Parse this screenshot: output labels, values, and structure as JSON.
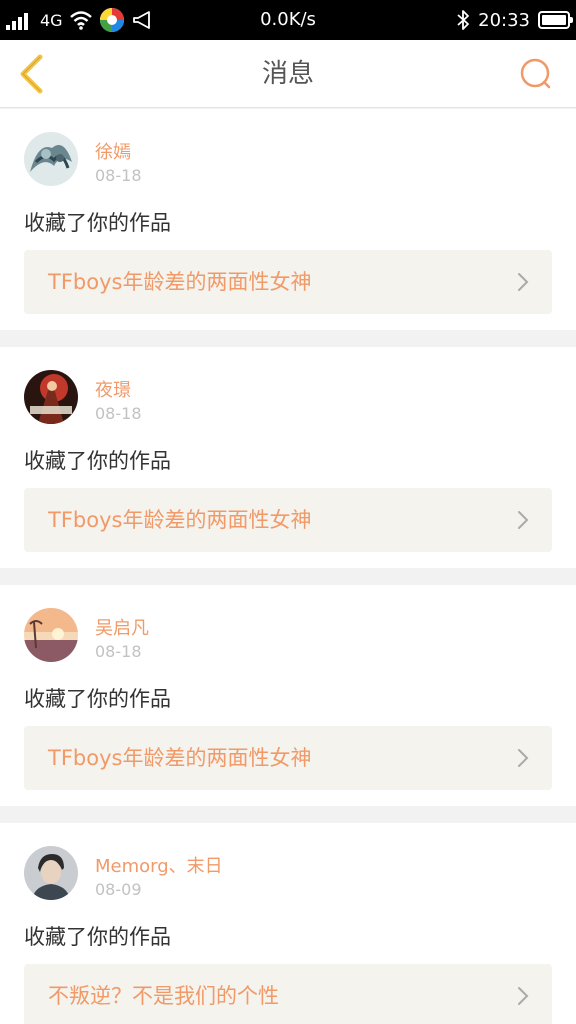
{
  "status_bar": {
    "network_type": "4G",
    "net_speed": "0.0K/s",
    "time": "20:33"
  },
  "navbar": {
    "title": "消息"
  },
  "colors": {
    "accent": "#f19a68",
    "back_arrow": "#f5c542",
    "card_bg": "#f4f3ee"
  },
  "messages": [
    {
      "username": "徐嫣",
      "date": "08-18",
      "action": "收藏了你的作品",
      "work_title": "TFboys年龄差的两面性女神",
      "avatar_icon": "avatar-1"
    },
    {
      "username": "夜璟",
      "date": "08-18",
      "action": "收藏了你的作品",
      "work_title": "TFboys年龄差的两面性女神",
      "avatar_icon": "avatar-2"
    },
    {
      "username": "吴启凡",
      "date": "08-18",
      "action": "收藏了你的作品",
      "work_title": "TFboys年龄差的两面性女神",
      "avatar_icon": "avatar-3"
    },
    {
      "username": "Memorg、末日",
      "date": "08-09",
      "action": "收藏了你的作品",
      "work_title": "不叛逆？不是我们的个性",
      "avatar_icon": "avatar-4"
    }
  ]
}
